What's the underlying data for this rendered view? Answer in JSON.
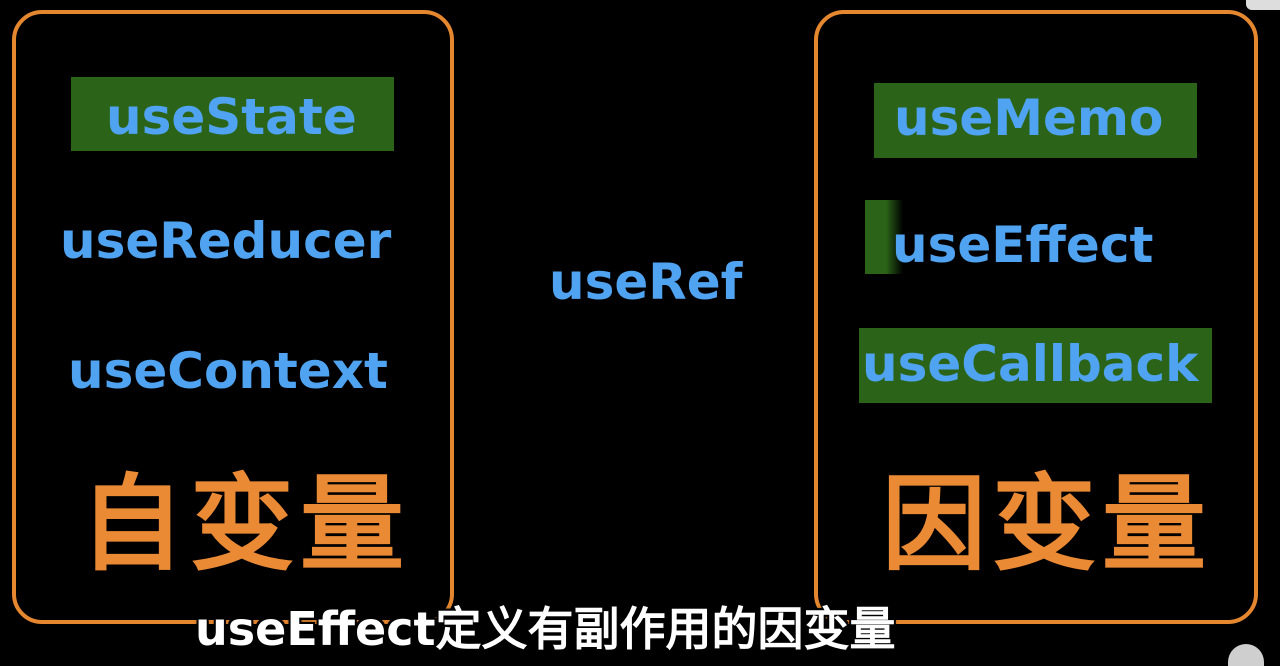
{
  "left_panel": {
    "hooks": [
      "useState",
      "useReducer",
      "useContext"
    ],
    "label": "自变量"
  },
  "center": {
    "hook": "useRef"
  },
  "right_panel": {
    "hooks": [
      "useMemo",
      "useEffect",
      "useCallback"
    ],
    "label": "因变量"
  },
  "subtitle": "useEffect定义有副作用的因变量",
  "colors": {
    "background": "#000000",
    "panel_border": "#e5872f",
    "hook_text": "#4fa3f0",
    "highlight": "#2b6418",
    "label_text": "#ea8a34",
    "subtitle_text": "#ffffff"
  }
}
